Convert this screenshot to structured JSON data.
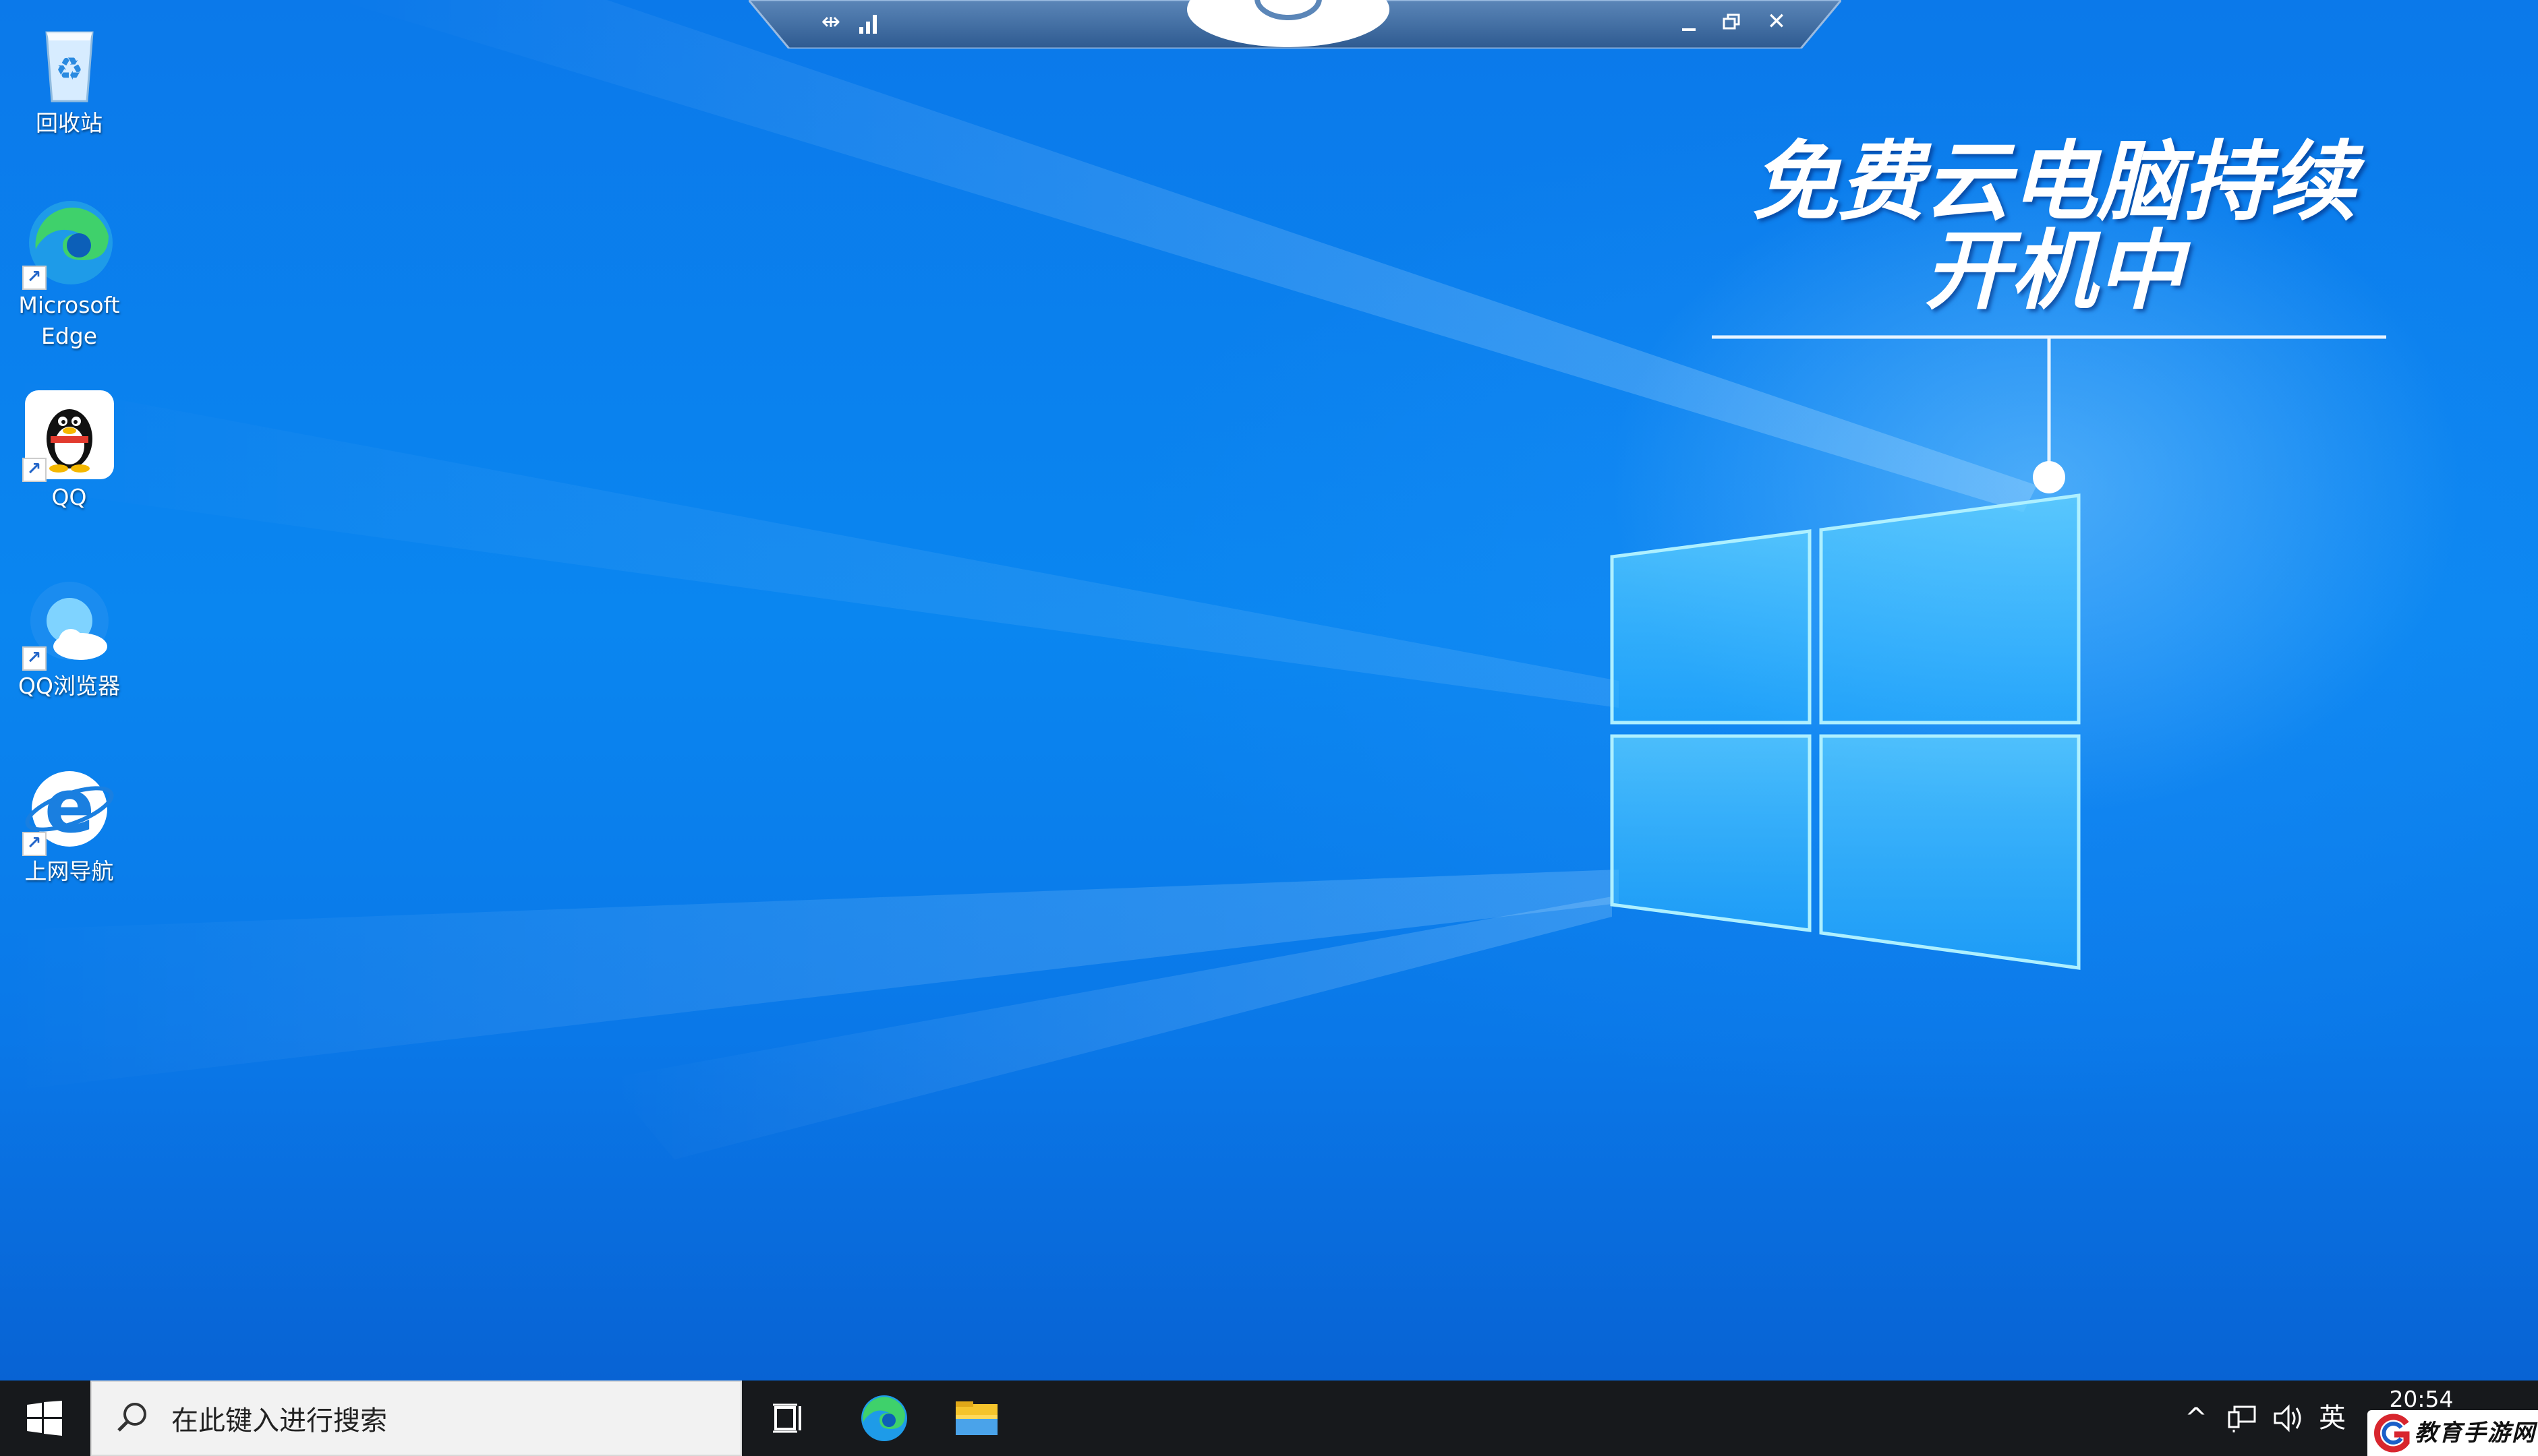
{
  "desktop": {
    "icons": [
      {
        "label": "回收站",
        "icon": "recycle-bin-icon"
      },
      {
        "label": "Microsoft Edge",
        "icon": "edge-icon"
      },
      {
        "label": "QQ",
        "icon": "qq-penguin-icon"
      },
      {
        "label": "QQ浏览器",
        "icon": "qq-browser-icon"
      },
      {
        "label": "上网导航",
        "icon": "ie-icon"
      }
    ]
  },
  "remote_toolbar": {
    "icons": [
      "pin-icon",
      "signal-icon",
      "cloud-logo-icon",
      "minimize-icon",
      "restore-icon",
      "close-icon"
    ]
  },
  "overlay": {
    "caption_line1": "免费云电脑持续",
    "caption_line2": "开机中"
  },
  "taskbar": {
    "search_placeholder": "在此键入进行搜索",
    "apps": [
      "task-view-icon",
      "edge-icon",
      "file-explorer-icon"
    ],
    "tray": {
      "chevron": "^",
      "input_language": "英",
      "time": "20:54"
    }
  },
  "watermark": {
    "text": "教育手游网"
  },
  "colors": {
    "desktop_blue": "#0a78e8",
    "taskbar": "#17191c",
    "search_box": "#f2f2f2"
  }
}
